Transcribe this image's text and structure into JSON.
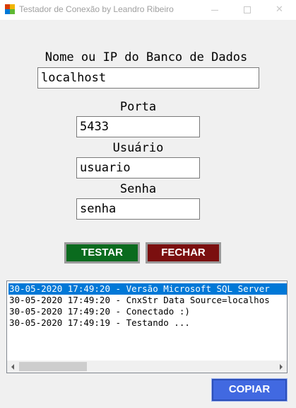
{
  "window": {
    "title": "Testador de Conexão by Leandro Ribeiro",
    "icon": "app-icon",
    "controls": [
      "minimize-icon",
      "maximize-icon",
      "close-icon"
    ]
  },
  "form": {
    "host_label": "Nome ou IP do Banco de Dados",
    "host_value": "localhost",
    "port_label": "Porta",
    "port_value": "5433",
    "user_label": "Usuário",
    "user_value": "usuario",
    "password_label": "Senha",
    "password_value": "senha"
  },
  "buttons": {
    "test_label": "TESTAR",
    "close_label": "FECHAR",
    "copy_label": "COPIAR"
  },
  "log": {
    "lines": [
      "30-05-2020 17:49:20 - Versão Microsoft SQL Server",
      "30-05-2020 17:49:20 - CnxStr Data Source=localhos",
      "30-05-2020 17:49:20 - Conectado :)",
      "30-05-2020 17:49:19 - Testando ..."
    ],
    "selected_index": 0
  },
  "colors": {
    "test_button": "#0a6b1e",
    "close_button": "#7b0f0f",
    "copy_button": "#4169e1",
    "selection": "#0078d7"
  }
}
